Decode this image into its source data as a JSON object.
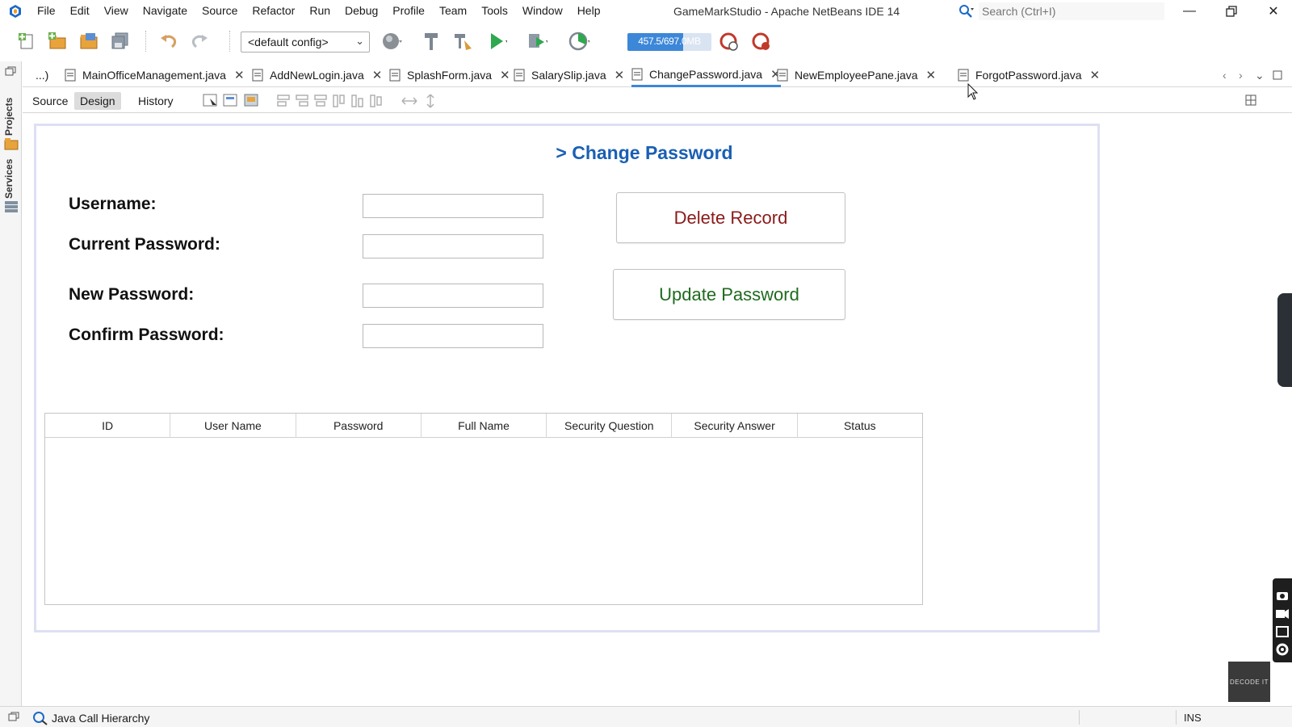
{
  "window": {
    "title": "GameMarkStudio - Apache NetBeans IDE 14",
    "search_placeholder": "Search (Ctrl+I)"
  },
  "menu": [
    "File",
    "Edit",
    "View",
    "Navigate",
    "Source",
    "Refactor",
    "Run",
    "Debug",
    "Profile",
    "Team",
    "Tools",
    "Window",
    "Help"
  ],
  "toolbar": {
    "config": "<default config>",
    "memory": "457.5/697.0MB",
    "memory_fraction": 0.66
  },
  "left_strip": {
    "projects_label": "Projects",
    "services_label": "Services"
  },
  "tabs": {
    "overflow": "...)",
    "items": [
      {
        "label": "MainOfficeManagement.java"
      },
      {
        "label": "AddNewLogin.java"
      },
      {
        "label": "SplashForm.java"
      },
      {
        "label": "SalarySlip.java"
      },
      {
        "label": "ChangePassword.java",
        "active": true
      },
      {
        "label": "NewEmployeePane.java"
      },
      {
        "label": "ForgotPassword.java"
      }
    ]
  },
  "subbar": {
    "source": "Source",
    "design": "Design",
    "history": "History"
  },
  "form": {
    "title": "> Change Password",
    "labels": {
      "username": "Username:",
      "current_password": "Current Password:",
      "new_password": "New Password:",
      "confirm_password": "Confirm Password:"
    },
    "buttons": {
      "delete": "Delete Record",
      "update": "Update Password"
    },
    "colors": {
      "title": "#1a5fb4",
      "delete": "#8b1a1a",
      "update": "#1e6b1e"
    },
    "table": {
      "columns": [
        "ID",
        "User Name",
        "Password",
        "Full Name",
        "Security Question",
        "Security Answer",
        "Status"
      ],
      "rows": []
    }
  },
  "statusbar": {
    "call_hierarchy": "Java Call Hierarchy",
    "mode": "INS"
  },
  "watermark": "DECODE IT"
}
